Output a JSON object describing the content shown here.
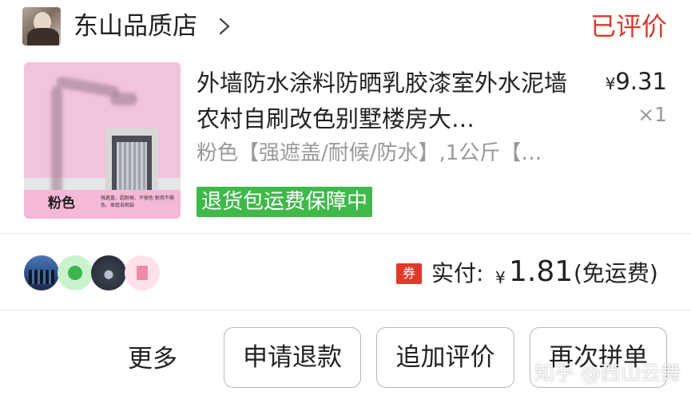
{
  "header": {
    "shop_name": "东山品质店",
    "status": "已评价"
  },
  "product": {
    "thumb_label": "粉色",
    "thumb_caption": "强遮盖、超耐候、不掉色 耐用不褪色、家庭自刷装",
    "title": "外墙防水涂料防晒乳胶漆室外水泥墙农村自刷改色别墅楼房大…",
    "price_symbol": "¥",
    "price": "9.31",
    "quantity": "×1",
    "spec": "粉色【强遮盖/耐候/防水】,1公斤【…",
    "guarantee": "退货包运费保障中"
  },
  "payment": {
    "coupon_badge": "券",
    "paid_label": "实付:",
    "currency": "¥",
    "amount": "1.81",
    "shipping_note": "(免运费)"
  },
  "actions": {
    "more": "更多",
    "refund": "申请退款",
    "add_review": "追加评价",
    "reorder": "再次拼单"
  },
  "watermark": "知乎 @西山云舞",
  "colors": {
    "status_red": "#d83a2c",
    "guarantee_green": "#3fb94a",
    "coupon_red": "#e0392b"
  },
  "icons": [
    "shop-avatar",
    "chevron-right-icon",
    "product-thumbnail",
    "friend-avatar-city",
    "friend-avatar-apple",
    "friend-avatar-night",
    "friend-avatar-trash",
    "coupon-icon"
  ]
}
